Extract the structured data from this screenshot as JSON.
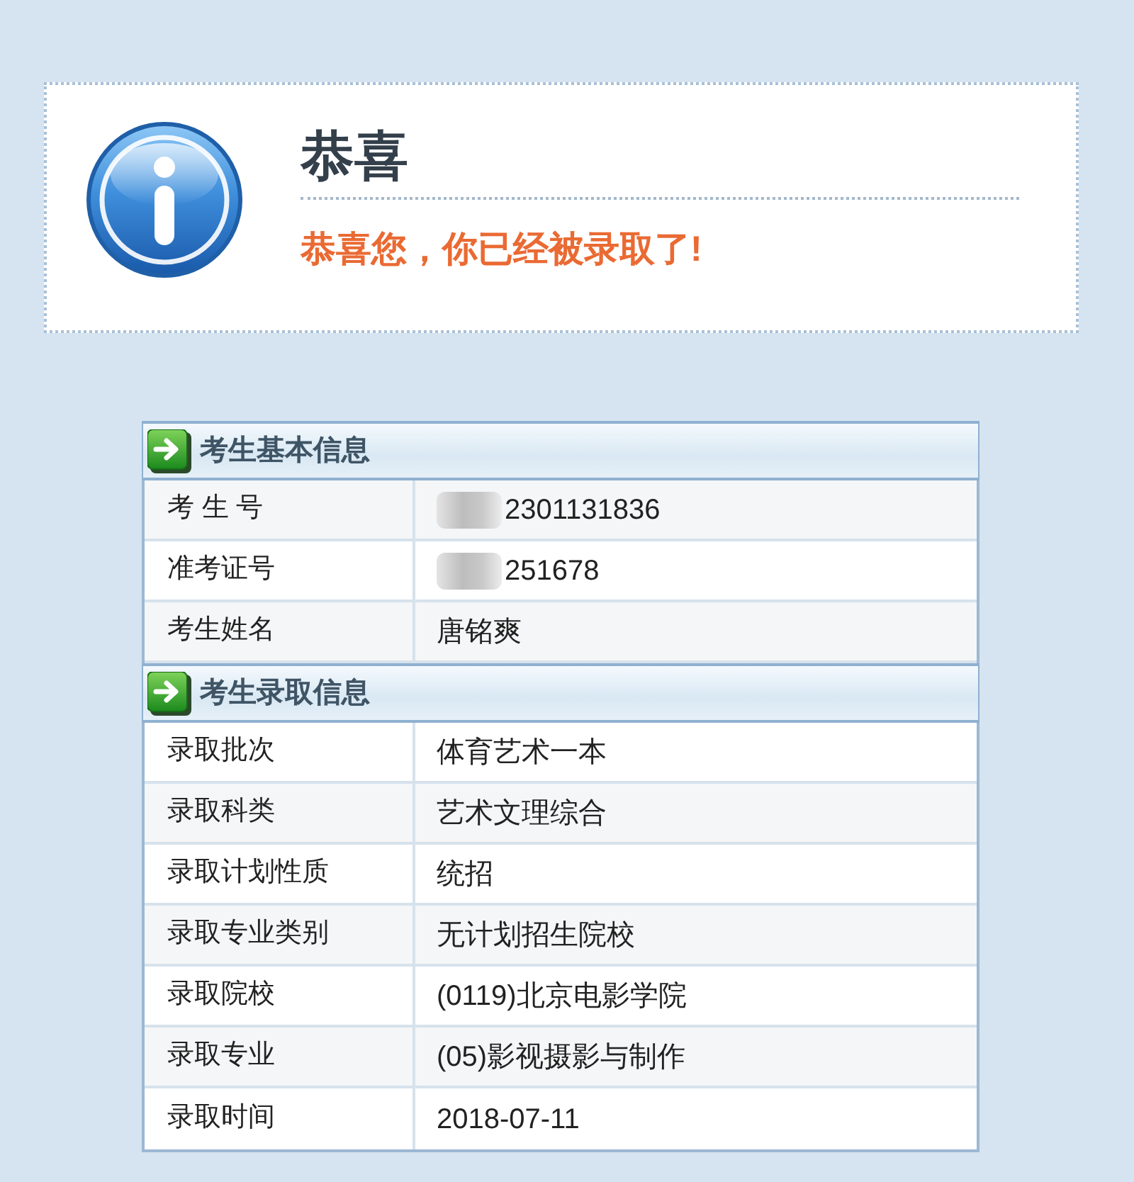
{
  "alert": {
    "title": "恭喜",
    "message": "恭喜您，你已经被录取了!"
  },
  "sections": [
    {
      "title": "考生基本信息",
      "rows": [
        {
          "label": "考 生 号",
          "value": "2301131836",
          "redacted": true
        },
        {
          "label": "准考证号",
          "value": "251678",
          "redacted": true
        },
        {
          "label": "考生姓名",
          "value": "唐铭爽",
          "redacted": false
        }
      ]
    },
    {
      "title": "考生录取信息",
      "rows": [
        {
          "label": "录取批次",
          "value": "体育艺术一本",
          "redacted": false
        },
        {
          "label": "录取科类",
          "value": "艺术文理综合",
          "redacted": false
        },
        {
          "label": "录取计划性质",
          "value": "统招",
          "redacted": false
        },
        {
          "label": "录取专业类别",
          "value": "无计划招生院校",
          "redacted": false
        },
        {
          "label": "录取院校",
          "value": "(0119)北京电影学院",
          "redacted": false
        },
        {
          "label": "录取专业",
          "value": "(05)影视摄影与制作",
          "redacted": false
        },
        {
          "label": "录取时间",
          "value": "2018-07-11",
          "redacted": false
        }
      ]
    }
  ]
}
